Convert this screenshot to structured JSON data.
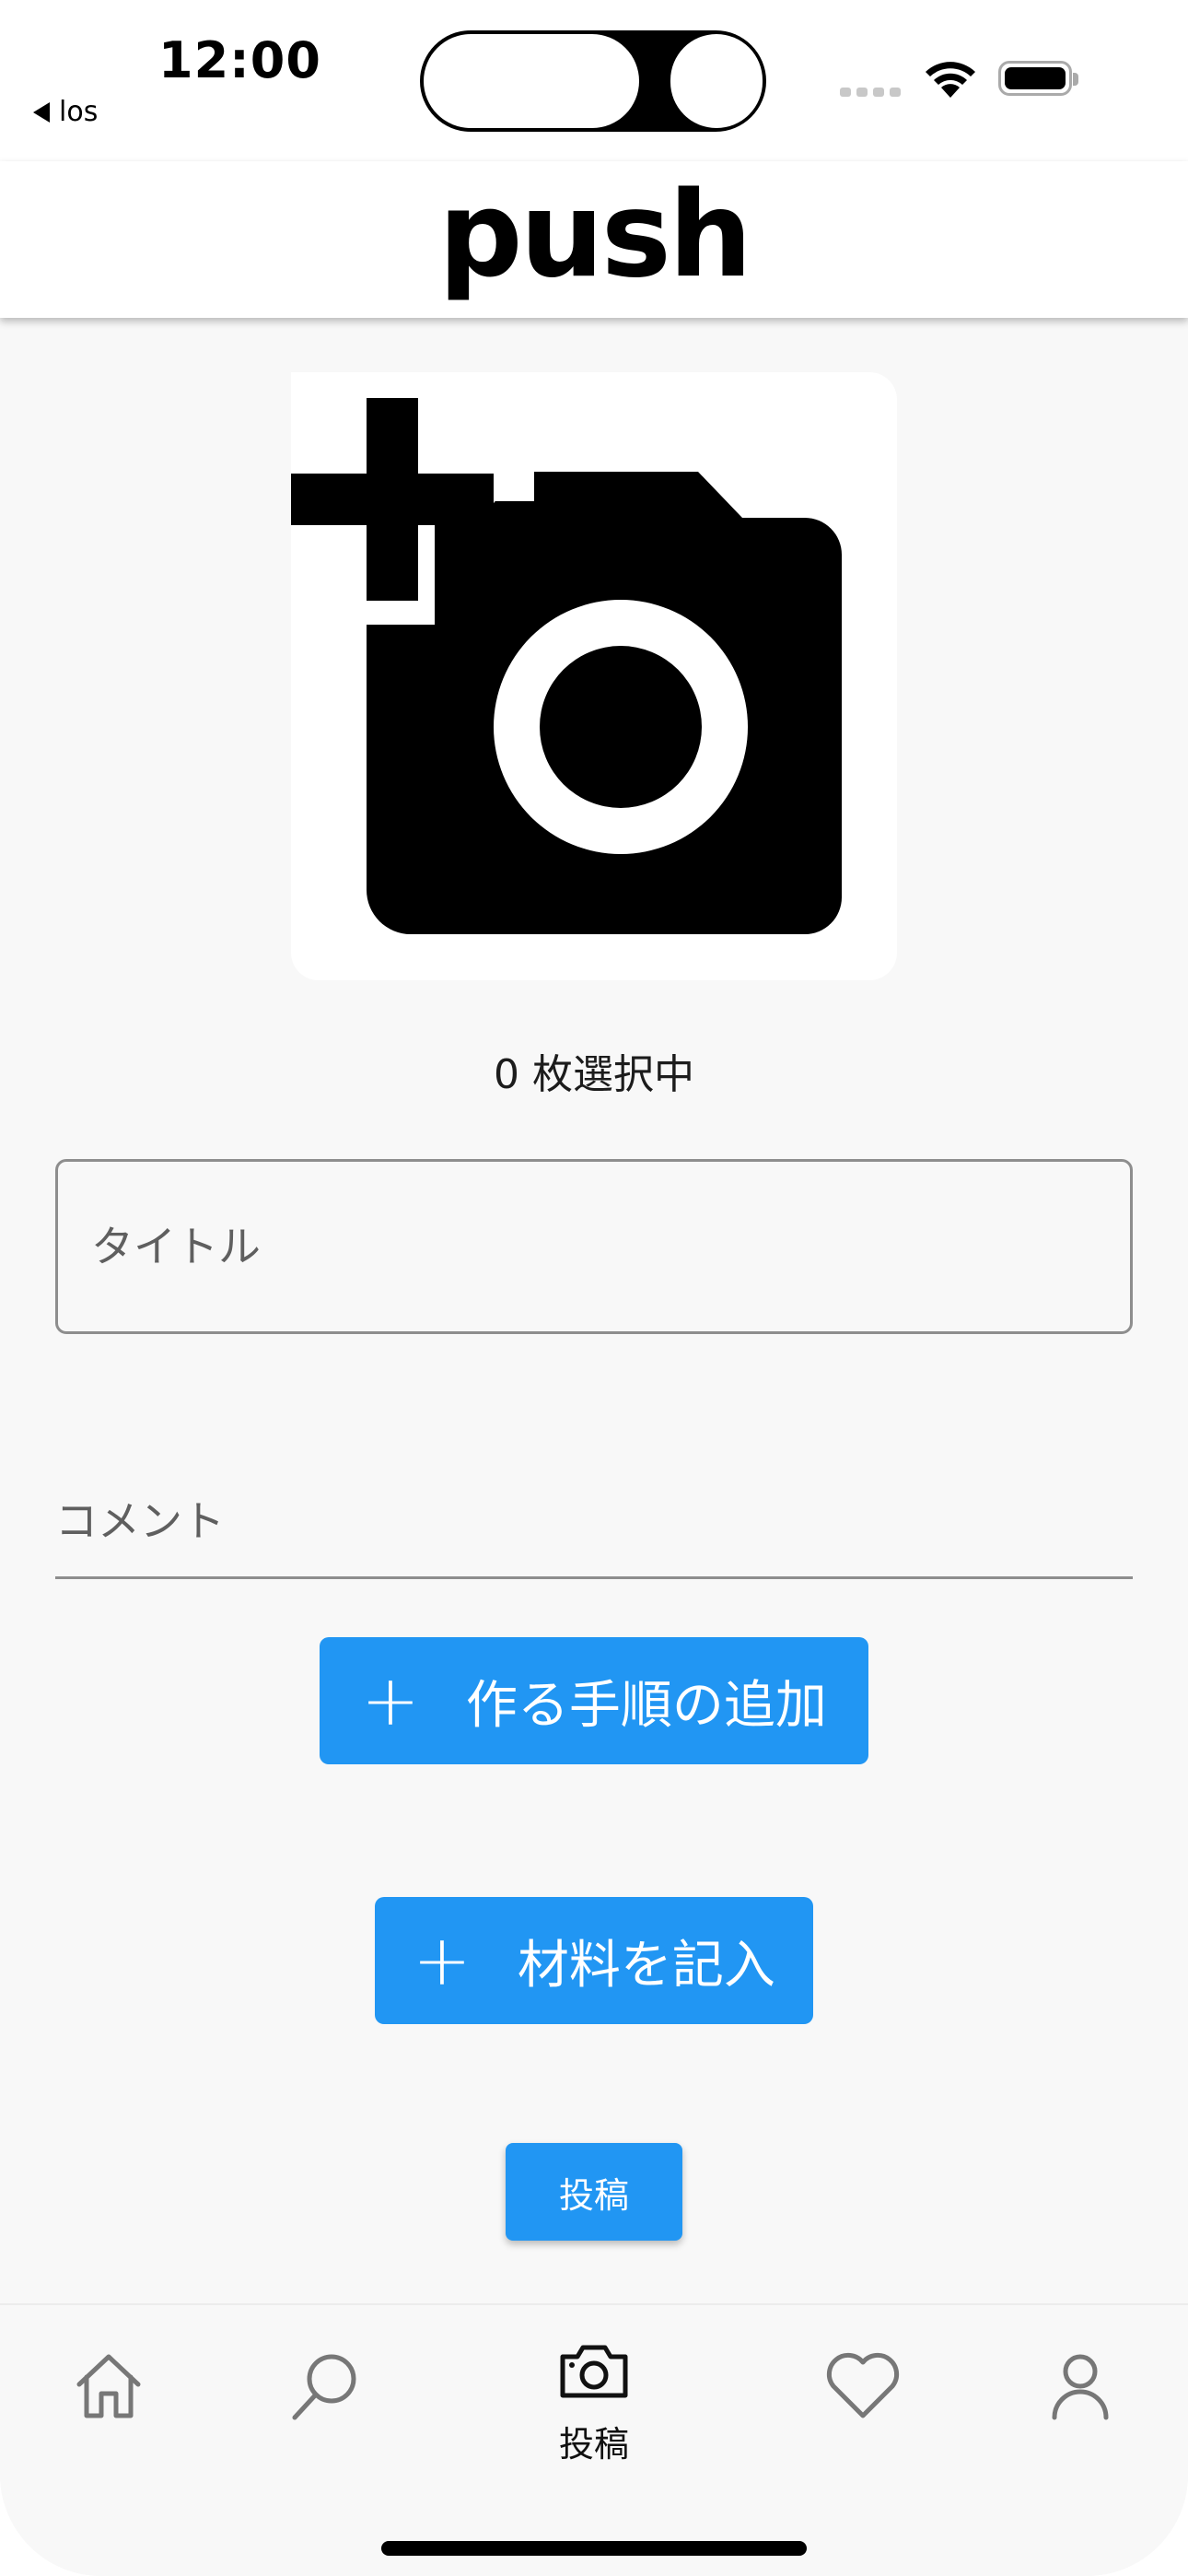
{
  "status_bar": {
    "time": "12:00",
    "back_app": "los"
  },
  "app_bar": {
    "logo": "push"
  },
  "upload": {
    "icon": "camera-add-icon",
    "selected_count": "0 枚選択中"
  },
  "form": {
    "title_placeholder": "タイトル",
    "comment_placeholder": "コメント"
  },
  "buttons": {
    "add_steps": "作る手順の追加",
    "add_ingredients": "材料を記入",
    "post": "投稿"
  },
  "bottom_nav": {
    "items": [
      {
        "icon": "home-icon",
        "label": ""
      },
      {
        "icon": "search-icon",
        "label": ""
      },
      {
        "icon": "camera-icon",
        "label": "投稿"
      },
      {
        "icon": "heart-icon",
        "label": ""
      },
      {
        "icon": "person-icon",
        "label": ""
      }
    ]
  },
  "colors": {
    "accent": "#2196f3",
    "background": "#f8f8f8"
  }
}
